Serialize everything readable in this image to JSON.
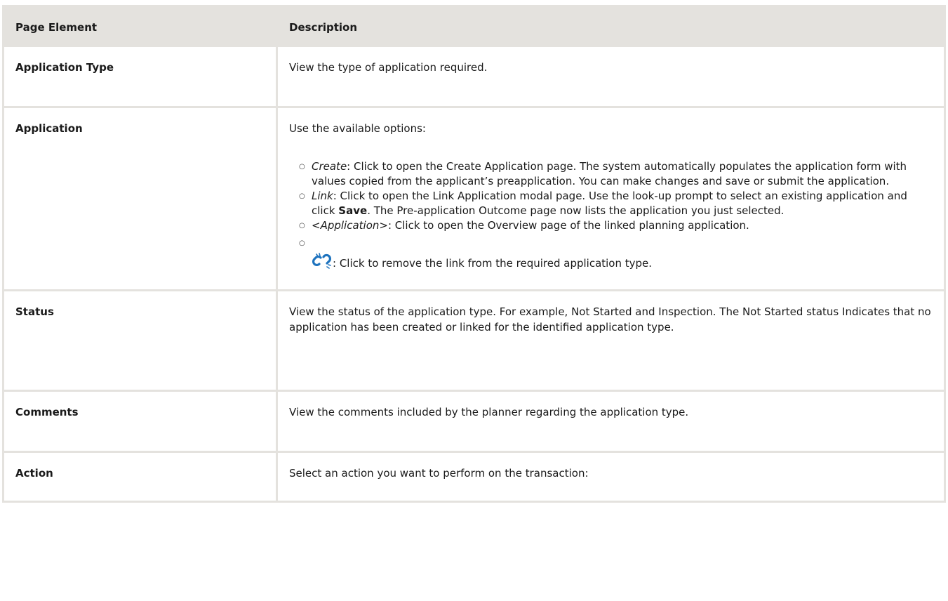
{
  "table": {
    "headers": {
      "page_element": "Page Element",
      "description": "Description"
    },
    "rows": {
      "application_type": {
        "name": "Application Type",
        "description": "View the type of application required."
      },
      "application": {
        "name": "Application",
        "intro": "Use the available options:",
        "options": {
          "create": {
            "term": "Create",
            "text": ": Click to open the Create Application page. The system automatically populates the application form with values copied from the applicant’s preapplication. You can make changes and save or submit the application."
          },
          "link": {
            "term": "Link",
            "text_before": ": Click to open the Link Application modal page. Use the look-up prompt to select an existing application and click ",
            "save": "Save",
            "text_after": ". The Pre-application Outcome page now lists the application you just selected."
          },
          "application_link": {
            "term": "<Application>",
            "text": ": Click to open the Overview page of the linked planning application."
          },
          "unlink": {
            "icon": "unlink-icon",
            "text": ": Click to remove the link from the required application type."
          }
        }
      },
      "status": {
        "name": "Status",
        "description": "View the status of the application type. For example, Not Started and Inspection. The Not Started status Indicates that no application has been created or linked for the identified application type."
      },
      "comments": {
        "name": "Comments",
        "description": "View the comments included by the planner regarding the application type."
      },
      "action": {
        "name": "Action",
        "description": "Select an action you want to perform on the transaction:"
      }
    }
  },
  "colors": {
    "header_bg": "#e4e2de",
    "border": "#e4e2de",
    "icon_blue": "#1e73be"
  }
}
